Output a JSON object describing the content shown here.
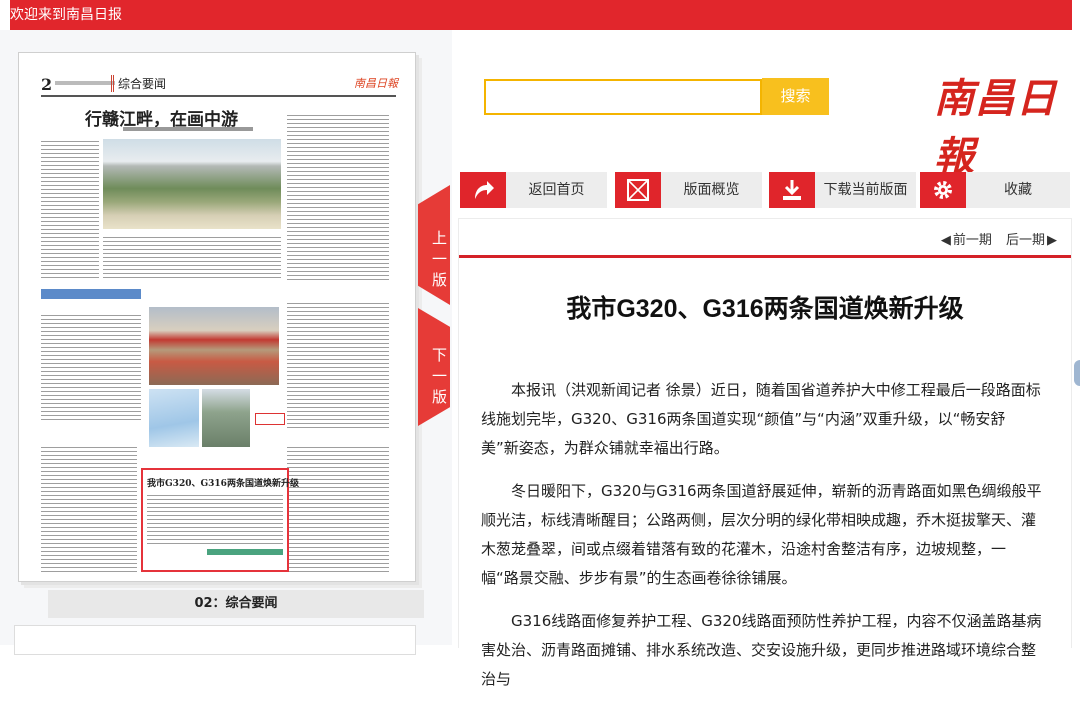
{
  "header": {
    "welcome": "欢迎来到南昌日报"
  },
  "paper": {
    "page_number": "2",
    "section": "综合要闻",
    "logo": "南昌日報",
    "headline": "行赣江畔，在画中游",
    "highlight_title": "我市G320、G316两条国道焕新升级",
    "caption": "02：综合要闻"
  },
  "nav": {
    "prev_page": "上一版",
    "next_page": "下一版"
  },
  "search": {
    "placeholder": "",
    "button": "搜索"
  },
  "brand": {
    "name": "南昌日報"
  },
  "toolbar": {
    "home": "返回首页",
    "overview": "版面概览",
    "download": "下载当前版面",
    "favorite": "收藏"
  },
  "article": {
    "prev_issue": "前一期",
    "next_issue": "后一期",
    "title": "我市G320、G316两条国道焕新升级",
    "paragraphs": [
      "本报讯（洪观新闻记者 徐景）近日，随着国省道养护大中修工程最后一段路面标线施划完毕，G320、G316两条国道实现“颜值”与“内涵”双重升级，以“畅安舒美”新姿态，为群众铺就幸福出行路。",
      "冬日暖阳下，G320与G316两条国道舒展延伸，崭新的沥青路面如黑色绸缎般平顺光洁，标线清晰醒目；公路两侧，层次分明的绿化带相映成趣，乔木挺拔擎天、灌木葱茏叠翠，间或点缀着错落有致的花灌木，沿途村舍整洁有序，边坡规整，一幅“路景交融、步步有景”的生态画卷徐徐铺展。",
      "G316线路面修复养护工程、G320线路面预防性养护工程，内容不仅涵盖路基病害处治、沥青路面摊铺、排水系统改造、交安设施升级，更同步推进路域环境综合整治与"
    ]
  },
  "colors": {
    "brand_red": "#e1262c",
    "search_yellow": "#f8c01e"
  }
}
